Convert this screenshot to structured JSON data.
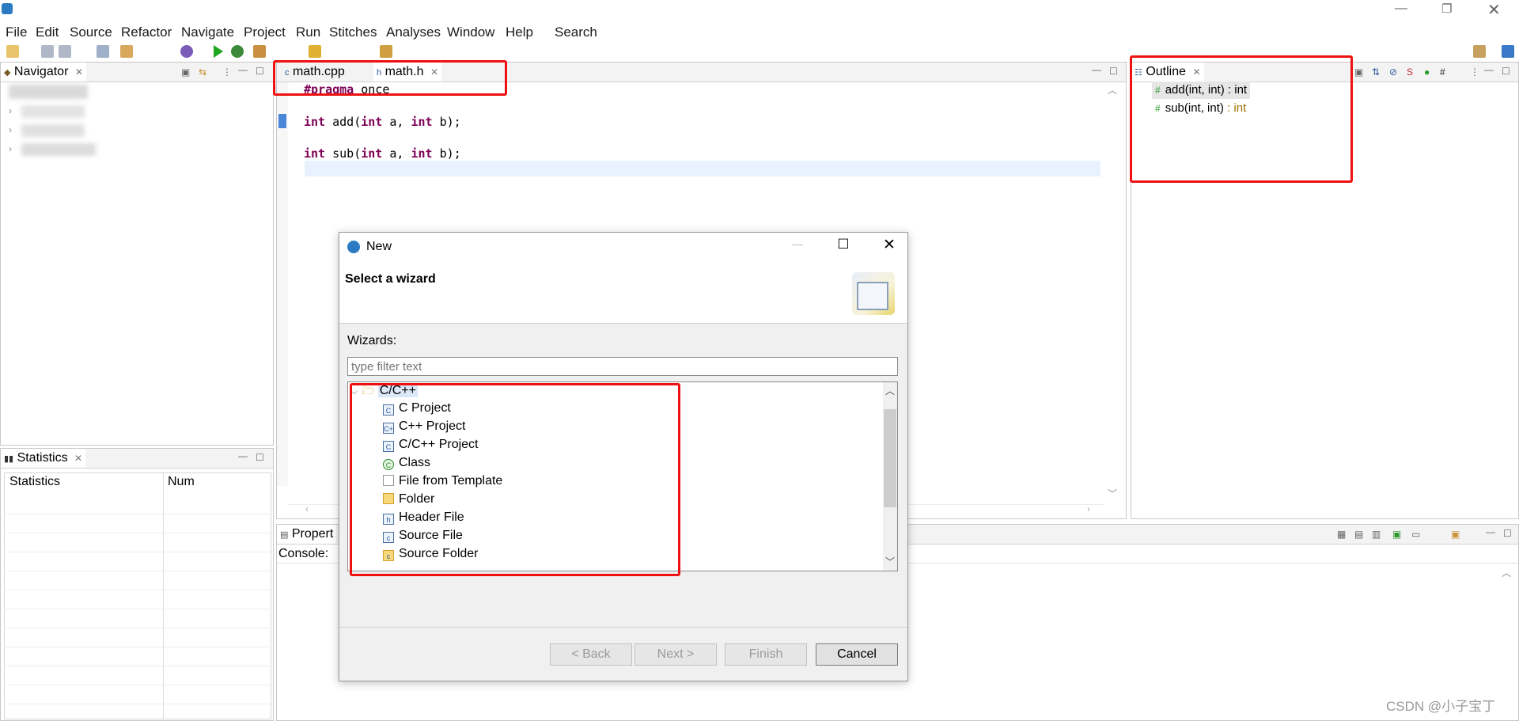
{
  "menubar": [
    "File",
    "Edit",
    "Source",
    "Refactor",
    "Navigate",
    "Project",
    "Run",
    "Stitches",
    "Analyses",
    "Window",
    "Help",
    "Search"
  ],
  "navigator": {
    "title": "Navigator"
  },
  "editor": {
    "tabs": [
      {
        "label": "math.cpp"
      },
      {
        "label": "math.h"
      }
    ],
    "code": [
      {
        "kw": "#pragma",
        "rest": " once"
      },
      {
        "kw": "int",
        "rest": " add(",
        "kw2": "int",
        "rest2": " a, ",
        "kw3": "int",
        "rest3": " b);"
      },
      {
        "kw": "int",
        "rest": " sub(",
        "kw2": "int",
        "rest2": " a, ",
        "kw3": "int",
        "rest3": " b);"
      }
    ]
  },
  "outline": {
    "title": "Outline",
    "items": [
      {
        "sig": "add(int, int)",
        "type": " : int"
      },
      {
        "sig": "sub(int, int)",
        "type": " : int"
      }
    ]
  },
  "statistics": {
    "title": "Statistics",
    "col1": "Statistics",
    "col2": "Num"
  },
  "properties": {
    "title": "Propert",
    "console_label": "Console:"
  },
  "dialog": {
    "title": "New",
    "heading": "Select a wizard",
    "wizards_label": "Wizards:",
    "filter_placeholder": "type filter text",
    "root": "C/C++",
    "items": [
      "C Project",
      "C++ Project",
      "C/C++ Project",
      "Class",
      "File from Template",
      "Folder",
      "Header File",
      "Source File",
      "Source Folder"
    ],
    "buttons": {
      "back": "< Back",
      "next": "Next >",
      "finish": "Finish",
      "cancel": "Cancel"
    }
  },
  "watermark": "CSDN @小子宝丁",
  "colors": {
    "keyword": "#7f0055",
    "highlight_red": "#ee1111",
    "type_color": "#a07000"
  }
}
